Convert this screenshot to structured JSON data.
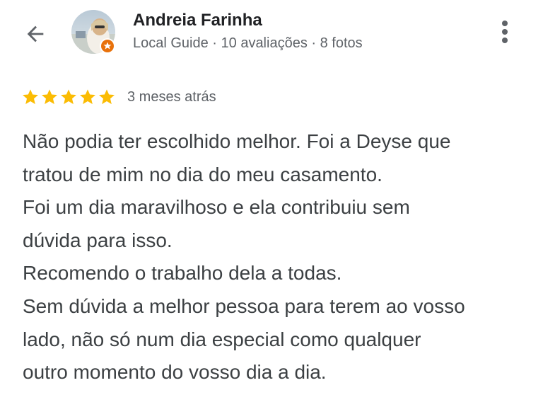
{
  "header": {
    "reviewer_name": "Andreia Farinha",
    "reviewer_meta": "Local Guide · 10 avaliações · 8 fotos",
    "back_icon": "arrow-back-icon",
    "more_icon": "more-vert-icon",
    "badge_icon": "local-guide-badge-icon"
  },
  "review": {
    "rating": 5,
    "rating_max": 5,
    "date": "3 meses atrás",
    "lines": [
      "Não podia ter escolhido melhor. Foi a Deyse que",
      "tratou de mim no dia do meu casamento.",
      "Foi um dia maravilhoso e ela contribuiu sem",
      "dúvida para isso.",
      "Recomendo o trabalho dela a todas.",
      "Sem dúvida a melhor pessoa para terem ao vosso",
      "lado, não só num dia especial como qualquer",
      "outro momento do vosso dia a dia."
    ]
  },
  "colors": {
    "star": "#fbbc04",
    "badge": "#e8710a",
    "text_primary": "#202124",
    "text_secondary": "#5f6368",
    "body_text": "#3c4043"
  }
}
